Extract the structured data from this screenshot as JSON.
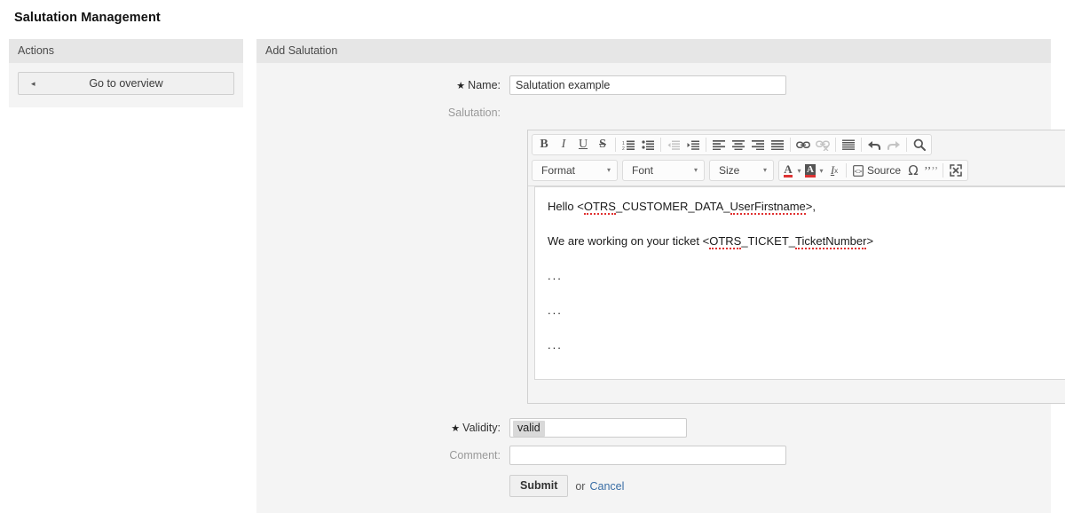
{
  "page": {
    "title": "Salutation Management"
  },
  "sidebar": {
    "header": "Actions",
    "overview_button": {
      "label": "Go to overview",
      "arrow": "◂"
    }
  },
  "main": {
    "header": "Add Salutation",
    "fields": {
      "name": {
        "label": "Name:",
        "required_marker": "★",
        "value": "Salutation example",
        "placeholder": ""
      },
      "salutation": {
        "label": "Salutation:"
      },
      "validity": {
        "label": "Validity:",
        "required_marker": "★",
        "selected": "valid"
      },
      "comment": {
        "label": "Comment:",
        "value": "",
        "placeholder": ""
      }
    },
    "actions": {
      "submit_label": "Submit",
      "or_label": "or",
      "cancel_label": "Cancel"
    }
  },
  "editor": {
    "toolbar_row1": [
      {
        "name": "bold-icon",
        "glyph": "B",
        "disabled": false
      },
      {
        "name": "italic-icon",
        "glyph": "I",
        "disabled": false
      },
      {
        "name": "underline-icon",
        "glyph": "U",
        "disabled": false
      },
      {
        "name": "strikethrough-icon",
        "glyph": "S",
        "disabled": false
      },
      {
        "name": "numbered-list-icon",
        "glyph": "",
        "disabled": false
      },
      {
        "name": "bulleted-list-icon",
        "glyph": "",
        "disabled": false
      },
      {
        "name": "decrease-indent-icon",
        "glyph": "",
        "disabled": true
      },
      {
        "name": "increase-indent-icon",
        "glyph": "",
        "disabled": false
      },
      {
        "name": "align-left-icon",
        "glyph": "",
        "disabled": false
      },
      {
        "name": "align-center-icon",
        "glyph": "",
        "disabled": false
      },
      {
        "name": "align-right-icon",
        "glyph": "",
        "disabled": false
      },
      {
        "name": "align-justify-icon",
        "glyph": "",
        "disabled": false
      },
      {
        "name": "link-icon",
        "glyph": "",
        "disabled": false
      },
      {
        "name": "unlink-icon",
        "glyph": "",
        "disabled": true
      },
      {
        "name": "blockquote-icon",
        "glyph": "",
        "disabled": false
      },
      {
        "name": "undo-icon",
        "glyph": "",
        "disabled": false
      },
      {
        "name": "redo-icon",
        "glyph": "",
        "disabled": true
      },
      {
        "name": "find-icon",
        "glyph": "",
        "disabled": false
      }
    ],
    "combos": {
      "format": "Format",
      "font": "Font",
      "size": "Size",
      "caret": "▾"
    },
    "toolbar_row2": {
      "text_color": "A",
      "bg_color": "A",
      "remove_format": "I",
      "source_label": "Source",
      "special_char": "Ω",
      "quotes": "٩ە",
      "maximize": "maximize-icon"
    },
    "content": {
      "line1_prefix": "Hello <",
      "line1_token_a": "OTRS",
      "line1_mid": "_CUSTOMER_DATA_",
      "line1_token_b": "UserFirstname",
      "line1_suffix": ">,",
      "line2_prefix": "We are working on your ticket <",
      "line2_token_a": "OTRS",
      "line2_mid": "_TICKET_",
      "line2_token_b": "TicketNumber",
      "line2_suffix": ">",
      "line3": "...",
      "line4": "...",
      "line5": "..."
    }
  },
  "colors": {
    "panel_header": "#e6e6e6",
    "panel_body": "#f4f4f4",
    "link": "#3a6ea5",
    "spellcheck": "#e03030"
  }
}
